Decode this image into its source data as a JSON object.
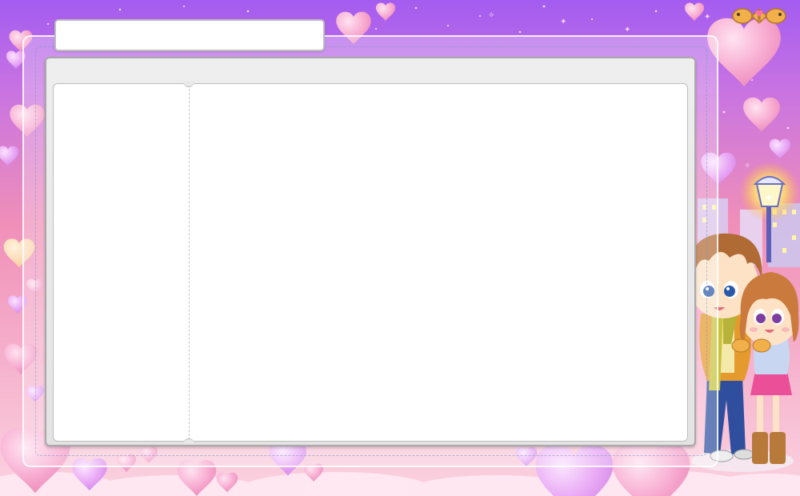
{
  "title_box": {
    "value": ""
  },
  "book": {
    "left_page_text": "",
    "right_page_text": ""
  },
  "colors": {
    "sky_top": "#a35cf0",
    "sky_mid": "#d57ad8",
    "sky_low": "#f7a6c3",
    "panel": "#e8e8e8",
    "panel_border": "#a8a8a8",
    "heart_pink": "#f9a8d4",
    "heart_lilac": "#e6a2f5"
  },
  "decorations": {
    "hearts": "heart-icon",
    "characters": "couple-illustration",
    "lamp": "street-lamp-icon",
    "fish": "taiyaki-fish-icon"
  }
}
